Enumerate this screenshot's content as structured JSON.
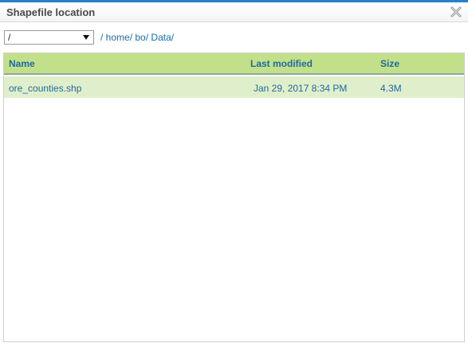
{
  "dialog": {
    "title": "Shapefile location"
  },
  "path": {
    "root_select_value": "/",
    "crumbs": [
      "/ ",
      "home/",
      " ",
      "bo/",
      " ",
      "Data/"
    ]
  },
  "table": {
    "headers": {
      "name": "Name",
      "modified": "Last modified",
      "size": "Size"
    },
    "rows": [
      {
        "name": "ore_counties.shp",
        "modified": "Jan 29, 2017 8:34 PM",
        "size": "4.3M"
      }
    ]
  },
  "colors": {
    "accent": "#2a7fc8",
    "header_bg": "#c2e08a",
    "row_bg": "#e0efcb",
    "link": "#1a6ea8"
  }
}
